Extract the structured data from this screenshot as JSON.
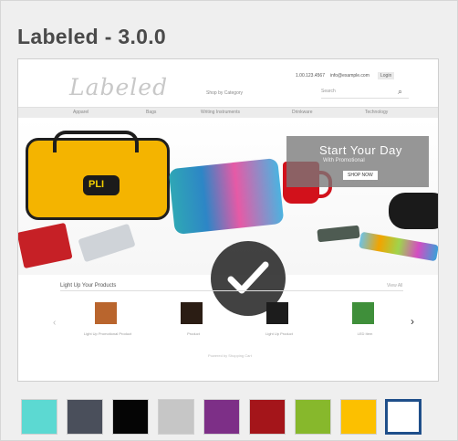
{
  "theme": {
    "title": "Labeled - 3.0.0"
  },
  "preview": {
    "tagline": "",
    "logo_text": "Labeled",
    "header": {
      "phone": "1.00.123.4567",
      "email": "info@example.com",
      "login": "Login",
      "category_select": "Shop by Category",
      "search_placeholder": "Search"
    },
    "nav": [
      "Apparel",
      "Bags",
      "Writing Instruments",
      "Drinkware",
      "Technology"
    ],
    "hero": {
      "overlay_title": "Start Your Day",
      "overlay_sub": "With Promotional",
      "overlay_button": "SHOP NOW"
    },
    "products": {
      "title": "Light Up Your Products",
      "view_all": "View All",
      "items": [
        {
          "caption": "Light Up Promotional Product"
        },
        {
          "caption": "Product"
        },
        {
          "caption": "Light Up Product"
        },
        {
          "caption": "LED Item"
        }
      ],
      "footer": "Powered by Shopping Cart"
    },
    "applied_badge": "checkmark"
  },
  "swatches": [
    {
      "color": "#5cd9d2",
      "selected": false
    },
    {
      "color": "#4a4f5b",
      "selected": false
    },
    {
      "color": "#050505",
      "selected": false
    },
    {
      "color": "#c6c6c6",
      "selected": false
    },
    {
      "color": "#7d2f87",
      "selected": false
    },
    {
      "color": "#a4151a",
      "selected": false
    },
    {
      "color": "#87b82c",
      "selected": false
    },
    {
      "color": "#fcc000",
      "selected": false
    },
    {
      "color": "#ffffff",
      "selected": true,
      "border_color": "#1f4f8a"
    }
  ]
}
